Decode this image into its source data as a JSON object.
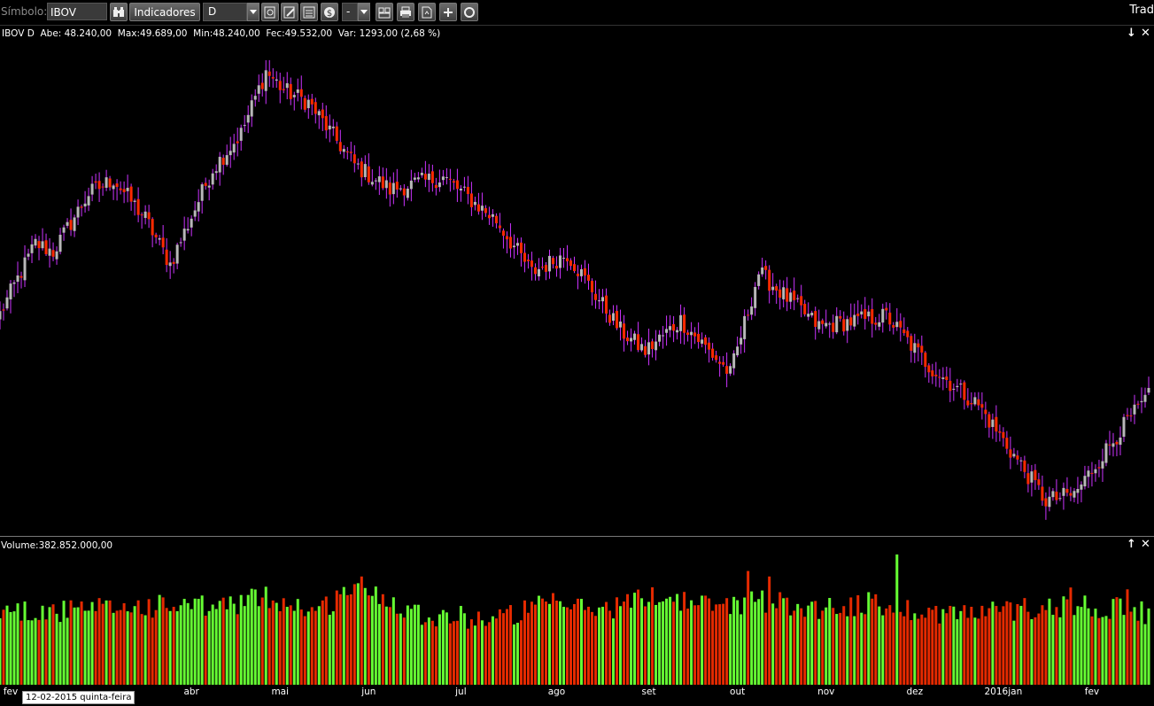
{
  "toolbar": {
    "symbol_label": "Símbolo:",
    "symbol_value": "IBOV",
    "indicators_label": "Indicadores",
    "period_value": "D",
    "zoom_value": "-",
    "right_label": "Trad"
  },
  "price_info": {
    "text": "IBOV D  Abe: 48.240,00  Max:49.689,00  Min:48.240,00  Fec:49.532,00  Var: 1293,00 (2,68 %)"
  },
  "volume_info": {
    "text": "Volume:382.852.000,00"
  },
  "tooltip": {
    "text": "12-02-2015 quinta-feira"
  },
  "colors": {
    "up": "#b8b8b8",
    "down": "#ff2a00",
    "wick": "#cc33ff",
    "vol_up": "#66ff33",
    "vol_down": "#e62a00",
    "background": "#000000"
  },
  "chart_data": {
    "type": "candlestick",
    "x_labels": [
      "fev",
      "abr",
      "mai",
      "jun",
      "jul",
      "ago",
      "set",
      "out",
      "nov",
      "dez",
      "2016jan",
      "fev"
    ],
    "price_anchors": [
      [
        0,
        46800
      ],
      [
        10,
        50200
      ],
      [
        15,
        49800
      ],
      [
        25,
        52600
      ],
      [
        32,
        53300
      ],
      [
        41,
        51400
      ],
      [
        48,
        49200
      ],
      [
        60,
        53800
      ],
      [
        68,
        55500
      ],
      [
        75,
        58500
      ],
      [
        80,
        57600
      ],
      [
        87,
        57000
      ],
      [
        100,
        54000
      ],
      [
        110,
        52800
      ],
      [
        125,
        53400
      ],
      [
        140,
        51300
      ],
      [
        150,
        48800
      ],
      [
        160,
        49700
      ],
      [
        175,
        46000
      ],
      [
        182,
        45000
      ],
      [
        192,
        46500
      ],
      [
        206,
        43900
      ],
      [
        214,
        48800
      ],
      [
        231,
        46200
      ],
      [
        250,
        46700
      ],
      [
        262,
        44300
      ],
      [
        276,
        42400
      ],
      [
        295,
        37800
      ],
      [
        303,
        38100
      ],
      [
        316,
        41200
      ],
      [
        324,
        42800
      ]
    ],
    "price_ylim": [
      36400,
      59800
    ],
    "volume_anchors": [
      [
        0,
        4.1
      ],
      [
        20,
        4.0
      ],
      [
        40,
        4.3
      ],
      [
        60,
        4.2
      ],
      [
        75,
        4.8
      ],
      [
        90,
        4.0
      ],
      [
        100,
        5.5
      ],
      [
        120,
        3.8
      ],
      [
        140,
        3.6
      ],
      [
        155,
        4.4
      ],
      [
        170,
        4.1
      ],
      [
        185,
        4.9
      ],
      [
        200,
        4.3
      ],
      [
        215,
        4.6
      ],
      [
        230,
        4.2
      ],
      [
        245,
        4.4
      ],
      [
        260,
        4.0
      ],
      [
        275,
        3.9
      ],
      [
        290,
        4.2
      ],
      [
        305,
        4.4
      ],
      [
        324,
        3.9
      ]
    ],
    "volume_ylim": [
      0,
      7.0
    ],
    "volume_spikes": [
      [
        102,
        5.9
      ],
      [
        211,
        6.2
      ],
      [
        217,
        5.9
      ],
      [
        253,
        7.1
      ],
      [
        302,
        5.3
      ],
      [
        318,
        5.2
      ]
    ]
  }
}
